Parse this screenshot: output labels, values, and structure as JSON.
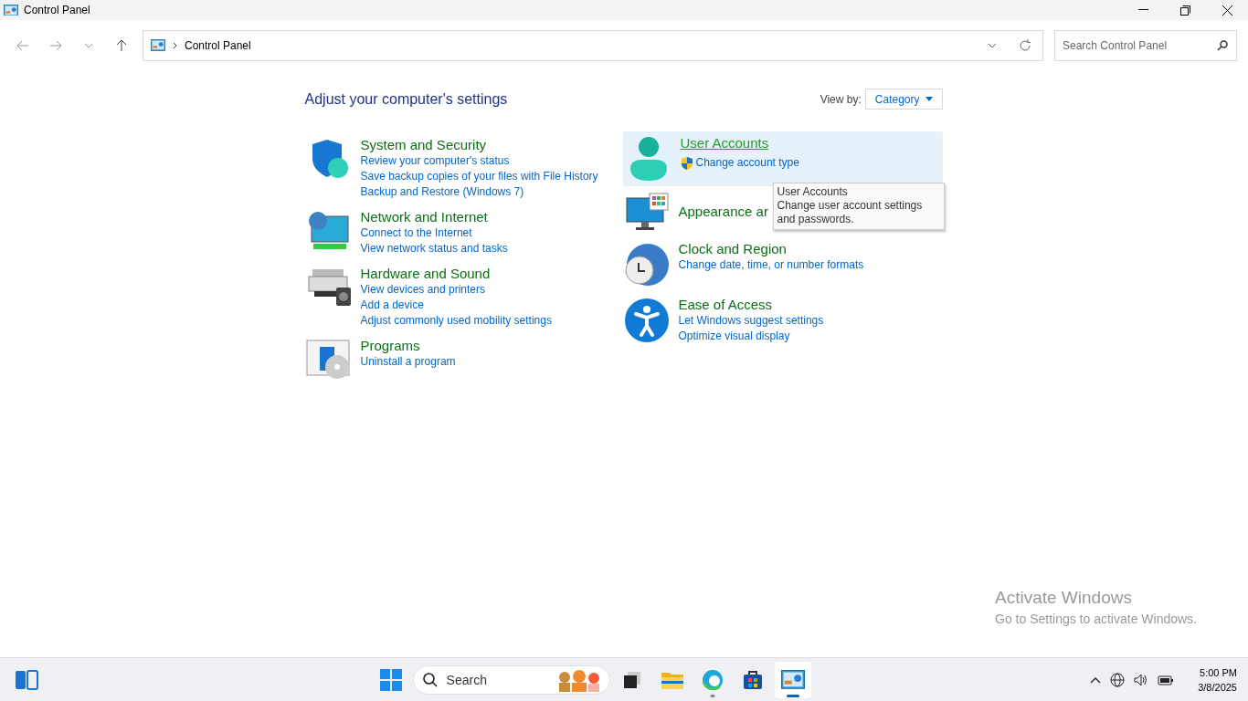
{
  "window": {
    "title": "Control Panel"
  },
  "address_bar": {
    "path": "Control Panel"
  },
  "search": {
    "placeholder": "Search Control Panel"
  },
  "heading": "Adjust your computer's settings",
  "view_by": {
    "label": "View by:",
    "value": "Category"
  },
  "columns": [
    [
      {
        "kind": "security",
        "title": "System and Security",
        "hovered": false,
        "links": [
          {
            "text": "Review your computer's status",
            "shield": false
          },
          {
            "text": "Save backup copies of your files with File History",
            "shield": false
          },
          {
            "text": "Backup and Restore (Windows 7)",
            "shield": false
          }
        ]
      },
      {
        "kind": "network",
        "title": "Network and Internet",
        "hovered": false,
        "links": [
          {
            "text": "Connect to the Internet",
            "shield": false
          },
          {
            "text": "View network status and tasks",
            "shield": false
          }
        ]
      },
      {
        "kind": "hardware",
        "title": "Hardware and Sound",
        "hovered": false,
        "links": [
          {
            "text": "View devices and printers",
            "shield": false
          },
          {
            "text": "Add a device",
            "shield": false
          },
          {
            "text": "Adjust commonly used mobility settings",
            "shield": false
          }
        ]
      },
      {
        "kind": "programs",
        "title": "Programs",
        "hovered": false,
        "links": [
          {
            "text": "Uninstall a program",
            "shield": false
          }
        ]
      }
    ],
    [
      {
        "kind": "user",
        "title": "User Accounts",
        "hovered": true,
        "links": [
          {
            "text": "Change account type",
            "shield": true
          }
        ]
      },
      {
        "kind": "appearance",
        "title": "Appearance ar",
        "hovered": false
      },
      {
        "kind": "clock",
        "title": "Clock and Region",
        "hovered": false,
        "links": [
          {
            "text": "Change date, time, or number formats",
            "shield": false
          }
        ]
      },
      {
        "kind": "access",
        "title": "Ease of Access",
        "hovered": false,
        "links": [
          {
            "text": "Let Windows suggest settings",
            "shield": false
          },
          {
            "text": "Optimize visual display",
            "shield": false
          }
        ]
      }
    ]
  ],
  "tooltip": {
    "title": "User Accounts",
    "text": "Change user account settings and passwords."
  },
  "watermark": {
    "title": "Activate Windows",
    "text": "Go to Settings to activate Windows."
  },
  "taskbar": {
    "search_placeholder": "Search",
    "apps": [
      {
        "kind": "start",
        "selected": false,
        "running": false
      },
      {
        "kind": "taskview",
        "selected": false,
        "running": false
      },
      {
        "kind": "explorer",
        "selected": false,
        "running": false
      },
      {
        "kind": "edge",
        "selected": false,
        "running": true
      },
      {
        "kind": "store",
        "selected": false,
        "running": false
      },
      {
        "kind": "controlpanel",
        "selected": true,
        "running": true
      }
    ],
    "clock": {
      "time": "5:00 PM",
      "date": "3/8/2025"
    }
  }
}
